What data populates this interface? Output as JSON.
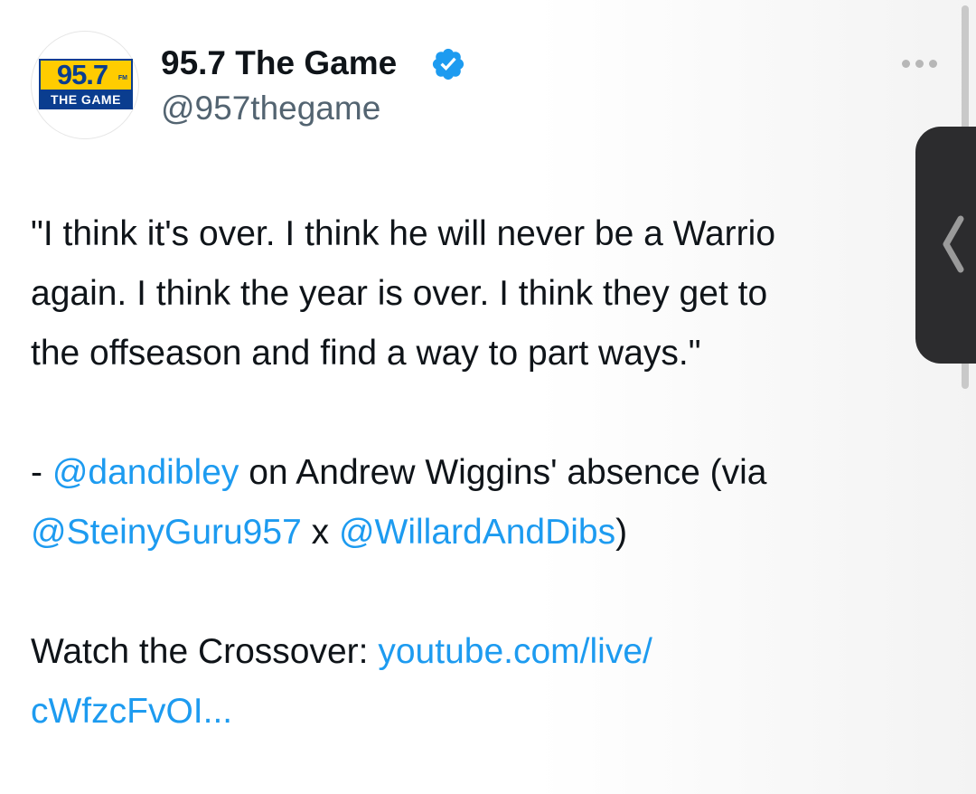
{
  "account": {
    "display_name": "95.7 The Game",
    "handle": "@957thegame",
    "verified": true,
    "logo": {
      "top_text": "95.7",
      "fm_text": "FM",
      "bottom_text": "THE GAME"
    }
  },
  "menu": {
    "icon": "more-horizontal-icon"
  },
  "tweet": {
    "quote_line1": "\"I think it's over. I think he will never be a Warrio",
    "quote_line2": "again. I think the year is over. I think they get to",
    "quote_line3": "the offseason and find a way to part ways.\"",
    "attr_dash": "- ",
    "mention1": "@dandibley",
    "attr_text1": " on Andrew Wiggins' absence (via",
    "mention2": "@SteinyGuru957",
    "attr_x": " x ",
    "mention3": "@WillardAndDibs",
    "attr_close": ")",
    "watch_label": "Watch the Crossover: ",
    "link_part1": "youtube.com/live/",
    "link_part2": "cWfzcFvOI..."
  },
  "overlay": {
    "icon": "chevron-left-icon"
  },
  "colors": {
    "link": "#1d9bf0",
    "handle": "#536471",
    "verified": "#1d9bf0",
    "logo_yellow": "#ffcc00",
    "logo_blue": "#0a3d8f"
  }
}
